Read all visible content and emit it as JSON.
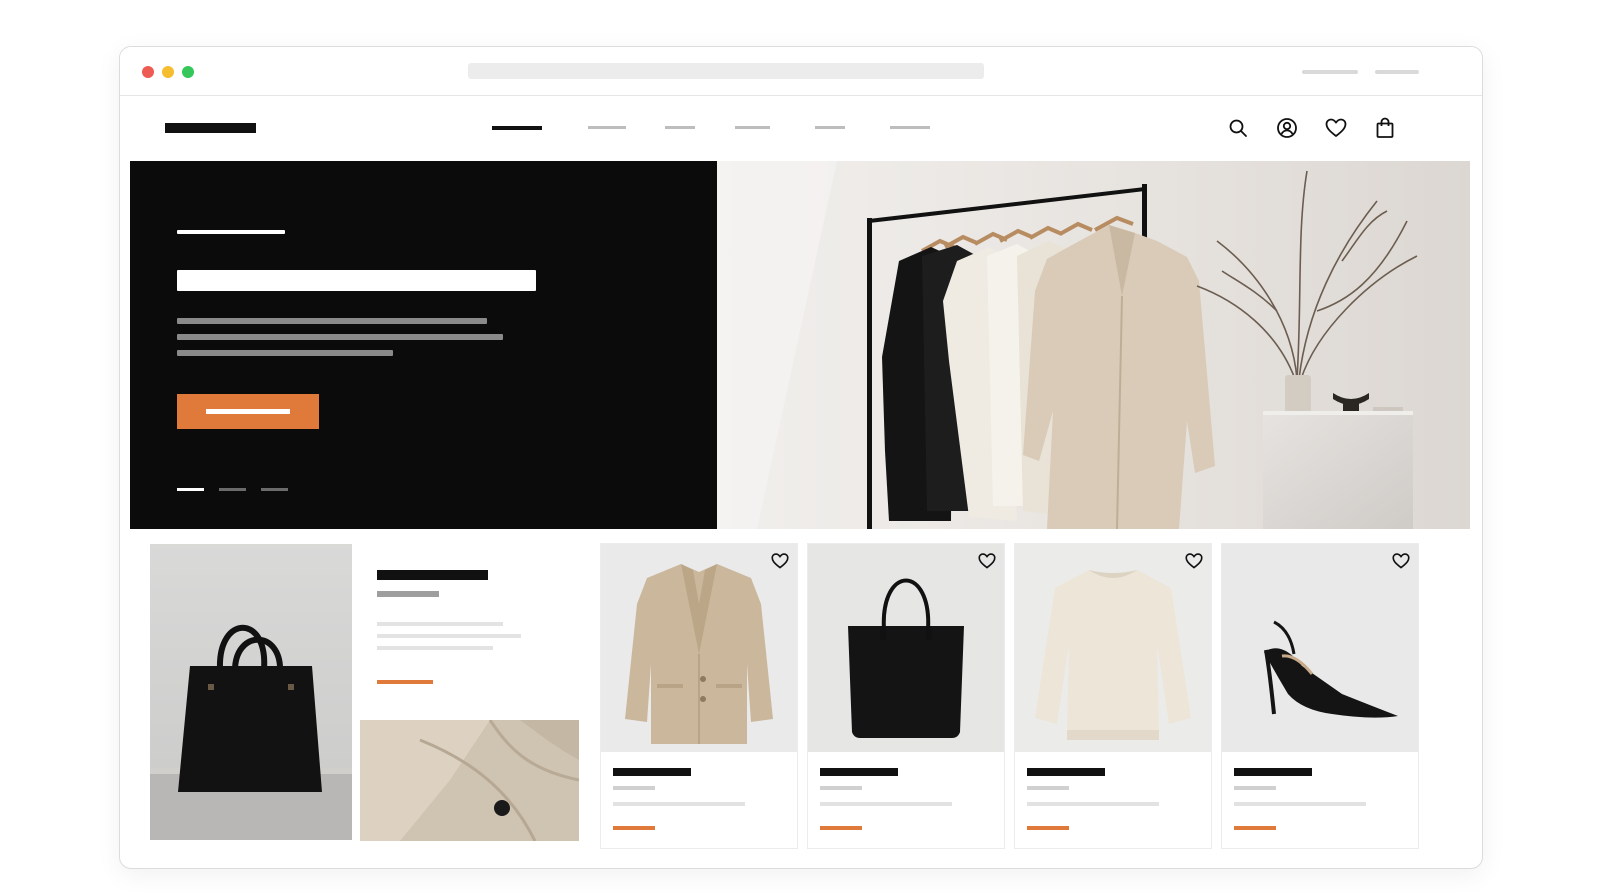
{
  "browser": {
    "traffic_lights": [
      "#ed5b53",
      "#f5bd2f",
      "#35c759"
    ]
  },
  "site": {
    "brand_text": "",
    "nav": [
      "",
      "",
      "",
      "",
      "",
      ""
    ],
    "icons": [
      "search-icon",
      "account-icon",
      "wishlist-icon",
      "bag-icon"
    ]
  },
  "hero": {
    "eyebrow": "",
    "headline": "",
    "body": "",
    "cta_label": "",
    "cta_color": "#e07a3a",
    "slides_total": 3,
    "active_slide": 1
  },
  "feature": {
    "title": "",
    "subtitle": "",
    "link_label": "",
    "accent": "#e07a3a"
  },
  "products": [
    {
      "name": "",
      "price": "",
      "image": "beige-blazer"
    },
    {
      "name": "",
      "price": "",
      "image": "black-tote"
    },
    {
      "name": "",
      "price": "",
      "image": "cream-sweater"
    },
    {
      "name": "",
      "price": "",
      "image": "black-slingback-heel"
    }
  ],
  "colors": {
    "accent": "#e07a3a",
    "dark": "#0b0b0b",
    "placeholder_text": "#111111"
  }
}
